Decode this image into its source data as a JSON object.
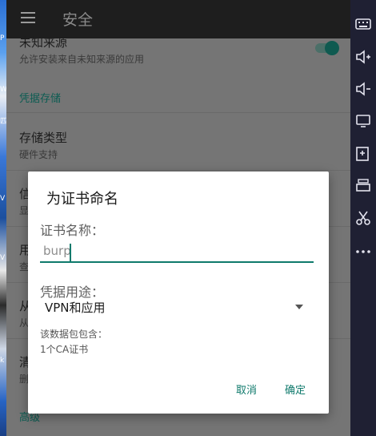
{
  "toolbar": {
    "title": "安全",
    "menu_icon": "hamburger-menu-icon"
  },
  "settings": {
    "unknown_sources": {
      "title": "未知来源",
      "subtitle": "允许安装来自未知来源的应用",
      "enabled": true
    },
    "credential_header": "凭据存储",
    "storage_type": {
      "title": "存储类型",
      "subtitle": "硬件支持"
    },
    "partial_items": [
      {
        "title": "信",
        "subtitle": "显"
      },
      {
        "title": "用",
        "subtitle": "查"
      },
      {
        "title": "从",
        "subtitle": "从"
      },
      {
        "title": "清",
        "subtitle": "删"
      }
    ],
    "advanced_header": "高级"
  },
  "dialog": {
    "title": "为证书命名",
    "name_label": "证书名称：",
    "name_value": "burp",
    "usage_label": "凭据用途：",
    "usage_value": "VPN和应用",
    "package_label": "该数据包包含：",
    "package_content": "1个CA证书",
    "cancel": "取消",
    "ok": "确定"
  },
  "sidebar": {
    "icons": [
      "keyboard-icon",
      "volume-up-icon",
      "volume-down-icon",
      "screen-icon",
      "apk-install-icon",
      "layers-icon",
      "scissors-icon",
      "more-icon"
    ]
  },
  "colors": {
    "accent": "#0f7a6c",
    "toolbar": "#1e1e1e",
    "sidebar": "#1f2033"
  }
}
